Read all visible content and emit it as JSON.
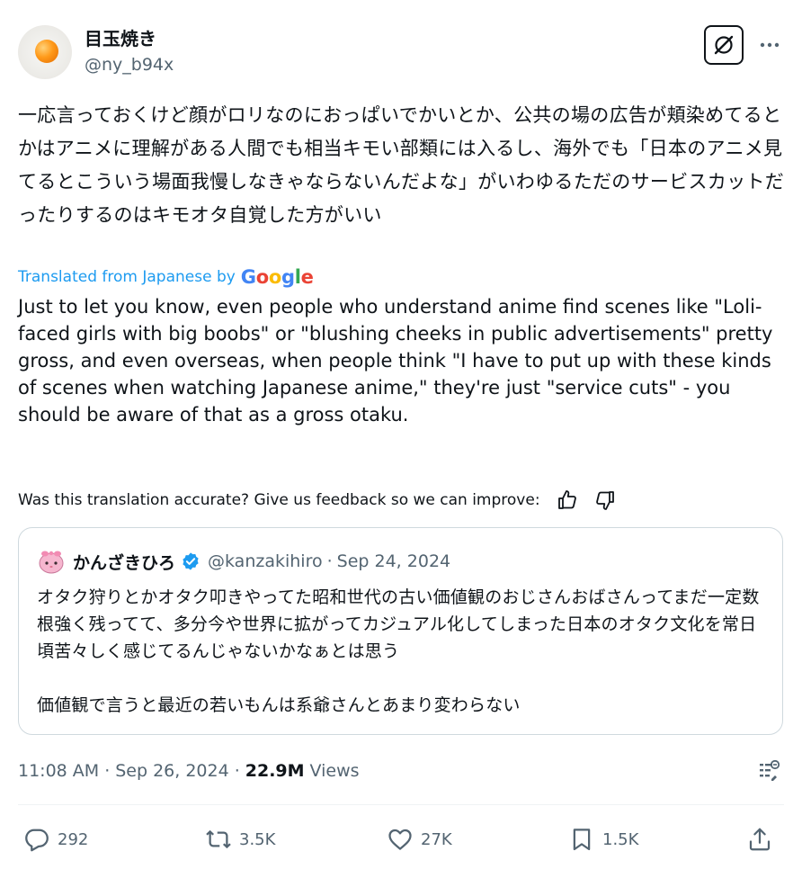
{
  "author": {
    "display_name": "目玉焼き",
    "handle": "@ny_b94x",
    "avatar_icon": "fried-egg-avatar"
  },
  "tweet": {
    "original_text": "一応言っておくけど顔がロリなのにおっぱいでかいとか、公共の場の広告が頬染めてるとかはアニメに理解がある人間でも相当キモい部類には入るし、海外でも「日本のアニメ見てるとこういう場面我慢しなきゃならないんだよな」がいわゆるただのサービスカットだったりするのはキモオタ自覚した方がいい",
    "translated_label": "Translated from Japanese by",
    "translation_provider": "Google",
    "translation": "Just to let you know, even people who understand anime find scenes like \"Loli-faced girls with big boobs\" or \"blushing cheeks in public advertisements\" pretty gross, and even overseas, when people think \"I have to put up with these kinds of scenes when watching Japanese anime,\" they're just \"service cuts\" - you should be aware of that as a gross otaku.",
    "feedback_prompt": "Was this translation accurate? Give us feedback so we can improve:"
  },
  "quote": {
    "display_name": "かんざきひろ",
    "handle": "@kanzakihiro",
    "separator": "·",
    "date": "Sep 24, 2024",
    "paragraphs": [
      "オタク狩りとかオタク叩きやってた昭和世代の古い価値観のおじさんおばさんってまだ一定数根強く残ってて、多分今や世界に拡がってカジュアル化してしまった日本のオタク文化を常日頃苦々しく感じてるんじゃないかなぁとは思う",
      "価値観で言うと最近の若いもんは系爺さんとあまり変わらない"
    ]
  },
  "meta": {
    "time": "11:08 AM",
    "separator": "·",
    "date": "Sep 26, 2024",
    "views_count": "22.9M",
    "views_label": "Views"
  },
  "actions": {
    "replies": "292",
    "reposts": "3.5K",
    "likes": "27K",
    "bookmarks": "1.5K"
  },
  "colors": {
    "text": "#0f1419",
    "secondary": "#536471",
    "link": "#1d9bf0",
    "border": "#cfd9de",
    "google_blue": "#4285f4",
    "google_red": "#ea4335",
    "google_yellow": "#fbbc05",
    "google_green": "#34a853"
  }
}
